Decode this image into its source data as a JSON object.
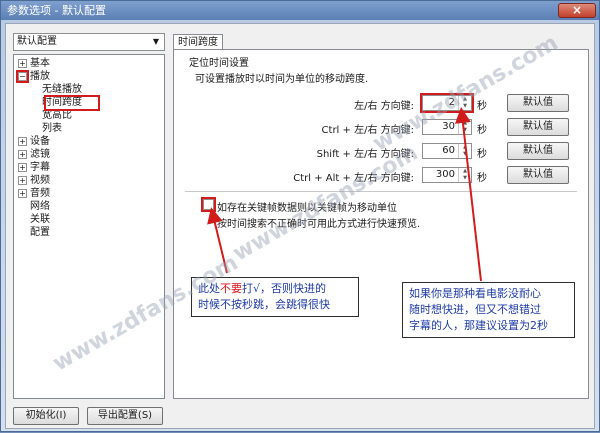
{
  "window": {
    "title": "参数选项 - 默认配置",
    "close_glyph": "×"
  },
  "sidebar": {
    "profile": "默认配置",
    "tree": [
      {
        "label": "基本",
        "expander": "+"
      },
      {
        "label": "播放",
        "expander": "−"
      },
      {
        "label": "无缝播放"
      },
      {
        "label": "时间跨度"
      },
      {
        "label": "宽高比"
      },
      {
        "label": "列表"
      },
      {
        "label": "设备",
        "expander": "+"
      },
      {
        "label": "滤镜",
        "expander": "+"
      },
      {
        "label": "字幕",
        "expander": "+"
      },
      {
        "label": "视频",
        "expander": "+"
      },
      {
        "label": "音频",
        "expander": "+"
      },
      {
        "label": "网络"
      },
      {
        "label": "关联"
      },
      {
        "label": "配置"
      }
    ]
  },
  "buttons": {
    "init": "初始化(I)",
    "export": "导出配置(S)"
  },
  "panel": {
    "tab": "时间跨度",
    "group_title": "定位时间设置",
    "group_desc": "可设置播放时以时间为单位的移动跨度.",
    "rows": [
      {
        "label": "左/右 方向键:",
        "value": "2",
        "unit": "秒",
        "button": "默认值"
      },
      {
        "label": "Ctrl + 左/右 方向键:",
        "value": "30",
        "unit": "秒",
        "button": "默认值"
      },
      {
        "label": "Shift + 左/右 方向键:",
        "value": "60",
        "unit": "秒",
        "button": "默认值"
      },
      {
        "label": "Ctrl + Alt + 左/右 方向键:",
        "value": "300",
        "unit": "秒",
        "button": "默认值"
      }
    ],
    "checkbox_label": "如存在关键帧数据则以关键帧为移动单位",
    "checkbox_hint": "按时间搜索不正确时可用此方式进行快速预览."
  },
  "annotations": {
    "left_note": {
      "pre": "此处",
      "warn": "不要",
      "mid": "打√，否则快进的",
      "line2": "时候不按秒跳，会跳得很快"
    },
    "right_note": {
      "line1": "如果你是那种看电影没耐心",
      "line2": "随时想快进，但又不想错过",
      "line3": "字幕的人，那建议设置为2秒"
    }
  },
  "watermark": "www.zdfans.com",
  "colors": {
    "accent_red": "#d21c1c",
    "note_blue": "#1e3ca5",
    "warn_red": "#e0141e"
  }
}
